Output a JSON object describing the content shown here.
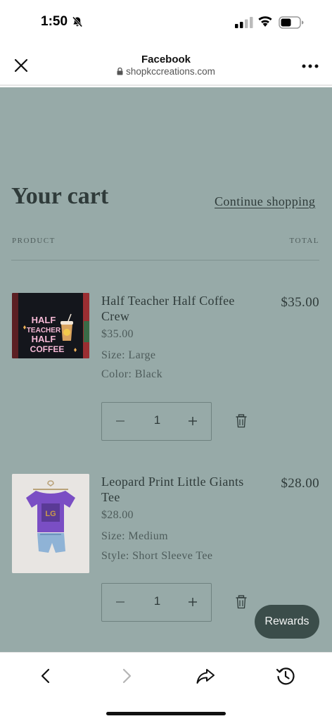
{
  "status_bar": {
    "time": "1:50",
    "icons": [
      "bell-slash-icon",
      "signal-icon",
      "wifi-icon",
      "battery-icon"
    ]
  },
  "browser": {
    "title": "Facebook",
    "url": "shopkccreations.com",
    "icons": [
      "close-icon",
      "lock-icon",
      "more-icon"
    ]
  },
  "cart": {
    "title": "Your cart",
    "continue_label": "Continue shopping",
    "col_product": "PRODUCT",
    "col_total": "TOTAL",
    "items": [
      {
        "name": "Half Teacher Half Coffee Crew",
        "price": "$35.00",
        "option1": "Size: Large",
        "option2": "Color: Black",
        "total": "$35.00",
        "quantity": "1",
        "image_text": [
          "HALF",
          "TEACHER",
          "HALF",
          "COFFEE"
        ]
      },
      {
        "name": "Leopard Print Little Giants Tee",
        "price": "$28.00",
        "option1": "Size: Medium",
        "option2": "Style: Short Sleeve Tee",
        "total": "$28.00",
        "quantity": "1"
      }
    ]
  },
  "rewards_label": "Rewards",
  "toolbar": {
    "icons": [
      "back-icon",
      "forward-icon",
      "share-icon",
      "history-icon"
    ]
  },
  "colors": {
    "page_bg": "#97aaa8",
    "text": "#2f3b3a",
    "rewards_bg": "#3b4d4a"
  }
}
